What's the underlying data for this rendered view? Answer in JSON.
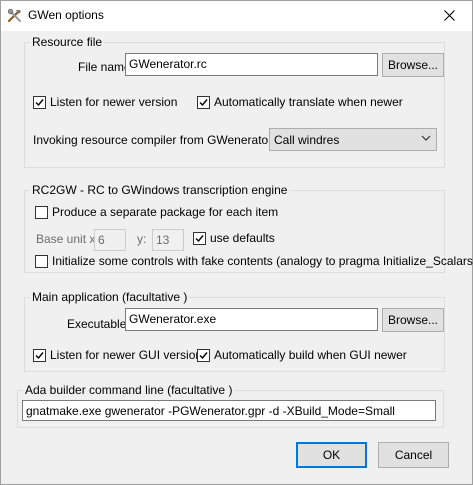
{
  "window": {
    "title": "GWen options"
  },
  "resource": {
    "group_title": "Resource file",
    "file_name_label": "File name",
    "file_name_value": "GWenerator.rc",
    "browse_label": "Browse...",
    "listen_label": "Listen for newer version",
    "listen_checked": true,
    "auto_translate_label": "Automatically translate when newer",
    "auto_translate_checked": true,
    "compiler_label": "Invoking resource compiler from GWenerator...",
    "compiler_value": "Call windres"
  },
  "rc2gw": {
    "group_title": "RC2GW - RC to GWindows transcription engine",
    "separate_package_label": "Produce a separate package for each item",
    "separate_package_checked": false,
    "base_unit_x_label": "Base unit x:",
    "base_unit_x_value": "6",
    "y_label": "y:",
    "y_value": "13",
    "use_defaults_label": "use defaults",
    "use_defaults_checked": true,
    "fake_contents_label": "Initialize some controls with fake contents (analogy to pragma Initialize_Scalars)",
    "fake_contents_checked": false
  },
  "main_app": {
    "group_title": "Main application (facultative )",
    "executable_label": "Executable",
    "executable_value": "GWenerator.exe",
    "browse_label": "Browse...",
    "listen_gui_label": "Listen for newer GUI version",
    "listen_gui_checked": true,
    "auto_build_label": "Automatically build when GUI newer",
    "auto_build_checked": true
  },
  "ada": {
    "group_title": "Ada builder command line (facultative )",
    "command_value": "gnatmake.exe gwenerator -PGWenerator.gpr -d -XBuild_Mode=Small"
  },
  "footer": {
    "ok_label": "OK",
    "cancel_label": "Cancel"
  },
  "colors": {
    "accent": "#0078d7",
    "face": "#f0f0f0",
    "button": "#e1e1e1"
  }
}
